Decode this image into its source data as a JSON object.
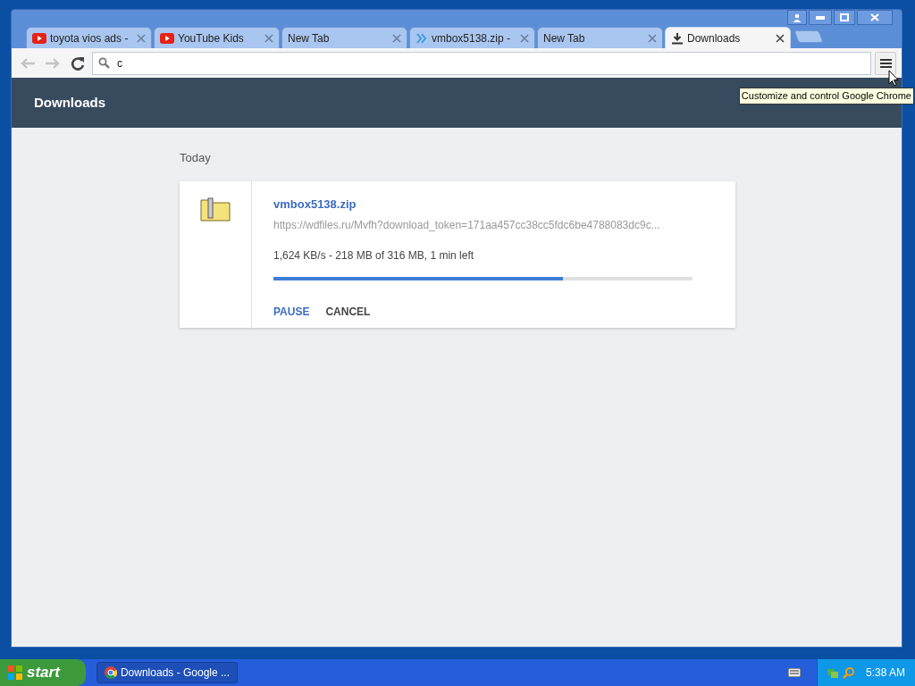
{
  "tabs": [
    {
      "title": "toyota vios ads -",
      "kind": "video",
      "selected": false
    },
    {
      "title": "YouTube Kids",
      "kind": "video",
      "selected": false
    },
    {
      "title": "New Tab",
      "kind": "blank",
      "selected": false
    },
    {
      "title": "vmbox5138.zip -",
      "kind": "site",
      "selected": false
    },
    {
      "title": "New Tab",
      "kind": "blank",
      "selected": false
    },
    {
      "title": "Downloads",
      "kind": "downloads",
      "selected": true
    }
  ],
  "omnibox": {
    "value": "c"
  },
  "tooltip": "Customize and control Google Chrome",
  "page": {
    "title": "Downloads",
    "section": "Today",
    "download": {
      "filename": "vmbox5138.zip",
      "url": "https://wdfiles.ru/Mvfh?download_token=171aa457cc38cc5fdc6be4788083dc9c...",
      "status": "1,624 KB/s - 218 MB of 316 MB, 1 min left",
      "level": 0.69,
      "actions": [
        "PAUSE",
        "CANCEL"
      ]
    }
  },
  "taskbar": {
    "start": "start",
    "tasks": [
      {
        "title": "Downloads - Google ...",
        "selected": true
      }
    ],
    "clock": "5:38 AM"
  }
}
